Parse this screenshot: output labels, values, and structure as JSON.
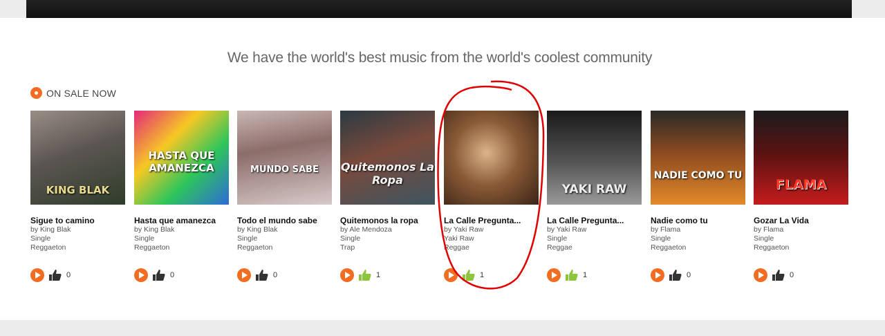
{
  "tagline": "We have the world's best music from the world's coolest community",
  "section": {
    "label": "ON SALE NOW",
    "icon": "disc-icon"
  },
  "colors": {
    "accent": "#f26c22",
    "like_active": "#8cc63f",
    "like_inactive": "#333333"
  },
  "albums": [
    {
      "title": "Sigue to camino",
      "artist": "by King Blak",
      "format": "Single",
      "genre": "Reggaeton",
      "likes": "0",
      "liked": false,
      "cover_text": "KING BLAK"
    },
    {
      "title": "Hasta que amanezca",
      "artist": "by King Blak",
      "format": "Single",
      "genre": "Reggaeton",
      "likes": "0",
      "liked": false,
      "cover_text": "HASTA QUE AMANEZCA"
    },
    {
      "title": "Todo el mundo sabe",
      "artist": "by King Blak",
      "format": "Single",
      "genre": "Reggaeton",
      "likes": "0",
      "liked": false,
      "cover_text": "MUNDO SABE"
    },
    {
      "title": "Quitemonos la ropa",
      "artist": "by Ale Mendoza",
      "format": "Single",
      "genre": "Trap",
      "likes": "1",
      "liked": true,
      "cover_text": "Quitemonos La Ropa"
    },
    {
      "title": "La Calle Pregunta...",
      "artist": "by Yaki Raw",
      "format": "Yaki Raw",
      "genre": "Reggae",
      "likes": "1",
      "liked": true,
      "cover_text": ""
    },
    {
      "title": "La Calle Pregunta...",
      "artist": "by Yaki Raw",
      "format": "Single",
      "genre": "Reggae",
      "likes": "1",
      "liked": true,
      "cover_text": "YAKI RAW"
    },
    {
      "title": "Nadie como tu",
      "artist": "by Flama",
      "format": "Single",
      "genre": "Reggaeton",
      "likes": "0",
      "liked": false,
      "cover_text": "NADIE COMO TU"
    },
    {
      "title": "Gozar La Vida",
      "artist": "by Flama",
      "format": "Single",
      "genre": "Reggaeton",
      "likes": "0",
      "liked": false,
      "cover_text": "FLAMA"
    }
  ]
}
